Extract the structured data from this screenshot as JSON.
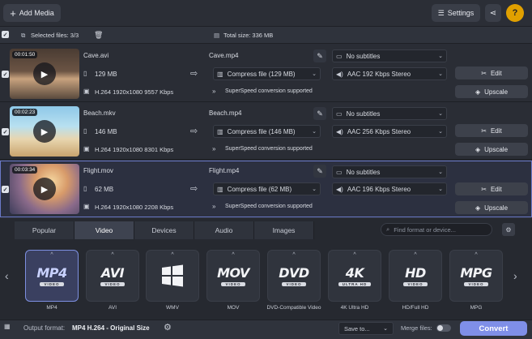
{
  "toolbar": {
    "add_media": "Add Media",
    "settings": "Settings",
    "share_icon": "share-icon",
    "help": "?"
  },
  "selection": {
    "selected_label": "Selected files: 3/3",
    "total_size": "Total size: 336 MB"
  },
  "files": [
    {
      "duration": "00:01:50",
      "name": "Cave.avi",
      "size": "129 MB",
      "video_info": "H.264 1920x1080 9557 Kbps",
      "output_name": "Cave.mp4",
      "compress": "Compress file (129 MB)",
      "superspeed": "SuperSpeed conversion supported",
      "subtitles": "No subtitles",
      "audio": "AAC 192 Kbps Stereo",
      "edit": "Edit",
      "upscale": "Upscale"
    },
    {
      "duration": "00:02:23",
      "name": "Beach.mkv",
      "size": "146 MB",
      "video_info": "H.264 1920x1080 8301 Kbps",
      "output_name": "Beach.mp4",
      "compress": "Compress file (146 MB)",
      "superspeed": "SuperSpeed conversion supported",
      "subtitles": "No subtitles",
      "audio": "AAC 256 Kbps Stereo",
      "edit": "Edit",
      "upscale": "Upscale"
    },
    {
      "duration": "00:03:34",
      "name": "Flight.mov",
      "size": "62 MB",
      "video_info": "H.264 1920x1080 2208 Kbps",
      "output_name": "Flight.mp4",
      "compress": "Compress file (62 MB)",
      "superspeed": "SuperSpeed conversion supported",
      "subtitles": "No subtitles",
      "audio": "AAC 196 Kbps Stereo",
      "edit": "Edit",
      "upscale": "Upscale"
    }
  ],
  "format_tabs": [
    "Popular",
    "Video",
    "Devices",
    "Audio",
    "Images"
  ],
  "active_tab": "Video",
  "search_placeholder": "Find format or device...",
  "formats": [
    {
      "logo": "MP4",
      "sub": "VIDEO",
      "label": "MP4"
    },
    {
      "logo": "AVI",
      "sub": "VIDEO",
      "label": "AVI"
    },
    {
      "logo": "",
      "sub": "",
      "label": "WMV"
    },
    {
      "logo": "MOV",
      "sub": "VIDEO",
      "label": "MOV"
    },
    {
      "logo": "DVD",
      "sub": "VIDEO",
      "label": "DVD-Compatible Video"
    },
    {
      "logo": "4K",
      "sub": "ULTRA HD",
      "label": "4K Ultra HD"
    },
    {
      "logo": "HD",
      "sub": "VIDEO",
      "label": "HD/Full HD"
    },
    {
      "logo": "MPG",
      "sub": "VIDEO",
      "label": "MPG"
    }
  ],
  "bottom": {
    "output_format_label": "Output format:",
    "output_format_value": "MP4 H.264 - Original Size",
    "save_to": "Save to...",
    "merge_files": "Merge files:",
    "convert": "Convert"
  },
  "colors": {
    "accent": "#7f8fe8",
    "help": "#e0a000"
  }
}
